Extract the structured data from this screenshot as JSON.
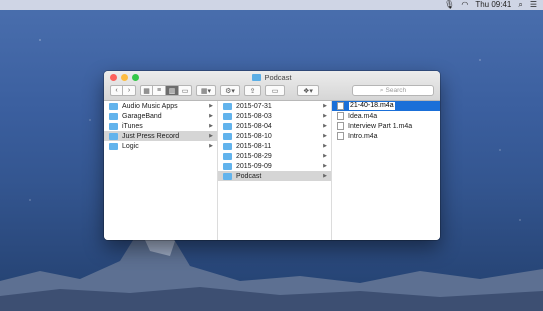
{
  "menubar": {
    "clock": "Thu 09:41"
  },
  "window": {
    "title": "Podcast",
    "search_placeholder": "Search",
    "columns": [
      {
        "items": [
          {
            "label": "Audio Music Apps",
            "type": "folder",
            "state": ""
          },
          {
            "label": "GarageBand",
            "type": "folder",
            "state": ""
          },
          {
            "label": "iTunes",
            "type": "folder",
            "state": ""
          },
          {
            "label": "Just Press Record",
            "type": "folder",
            "state": "selected-grey"
          },
          {
            "label": "Logic",
            "type": "folder",
            "state": ""
          }
        ]
      },
      {
        "items": [
          {
            "label": "2015-07-31",
            "type": "folder",
            "state": ""
          },
          {
            "label": "2015-08-03",
            "type": "folder",
            "state": ""
          },
          {
            "label": "2015-08-04",
            "type": "folder",
            "state": ""
          },
          {
            "label": "2015-08-10",
            "type": "folder",
            "state": ""
          },
          {
            "label": "2015-08-11",
            "type": "folder",
            "state": ""
          },
          {
            "label": "2015-08-29",
            "type": "folder",
            "state": ""
          },
          {
            "label": "2015-09-09",
            "type": "folder",
            "state": ""
          },
          {
            "label": "Podcast",
            "type": "folder",
            "state": "selected-grey"
          }
        ]
      },
      {
        "items": [
          {
            "label": "21-40-18.m4a",
            "type": "file",
            "state": "selected-blue-editing"
          },
          {
            "label": "Idea.m4a",
            "type": "file",
            "state": ""
          },
          {
            "label": "Interview Part 1.m4a",
            "type": "file",
            "state": ""
          },
          {
            "label": "Intro.m4a",
            "type": "file",
            "state": ""
          }
        ]
      }
    ]
  },
  "colors": {
    "selection_blue": "#1a6fd8",
    "folder_blue": "#62b3ec"
  }
}
